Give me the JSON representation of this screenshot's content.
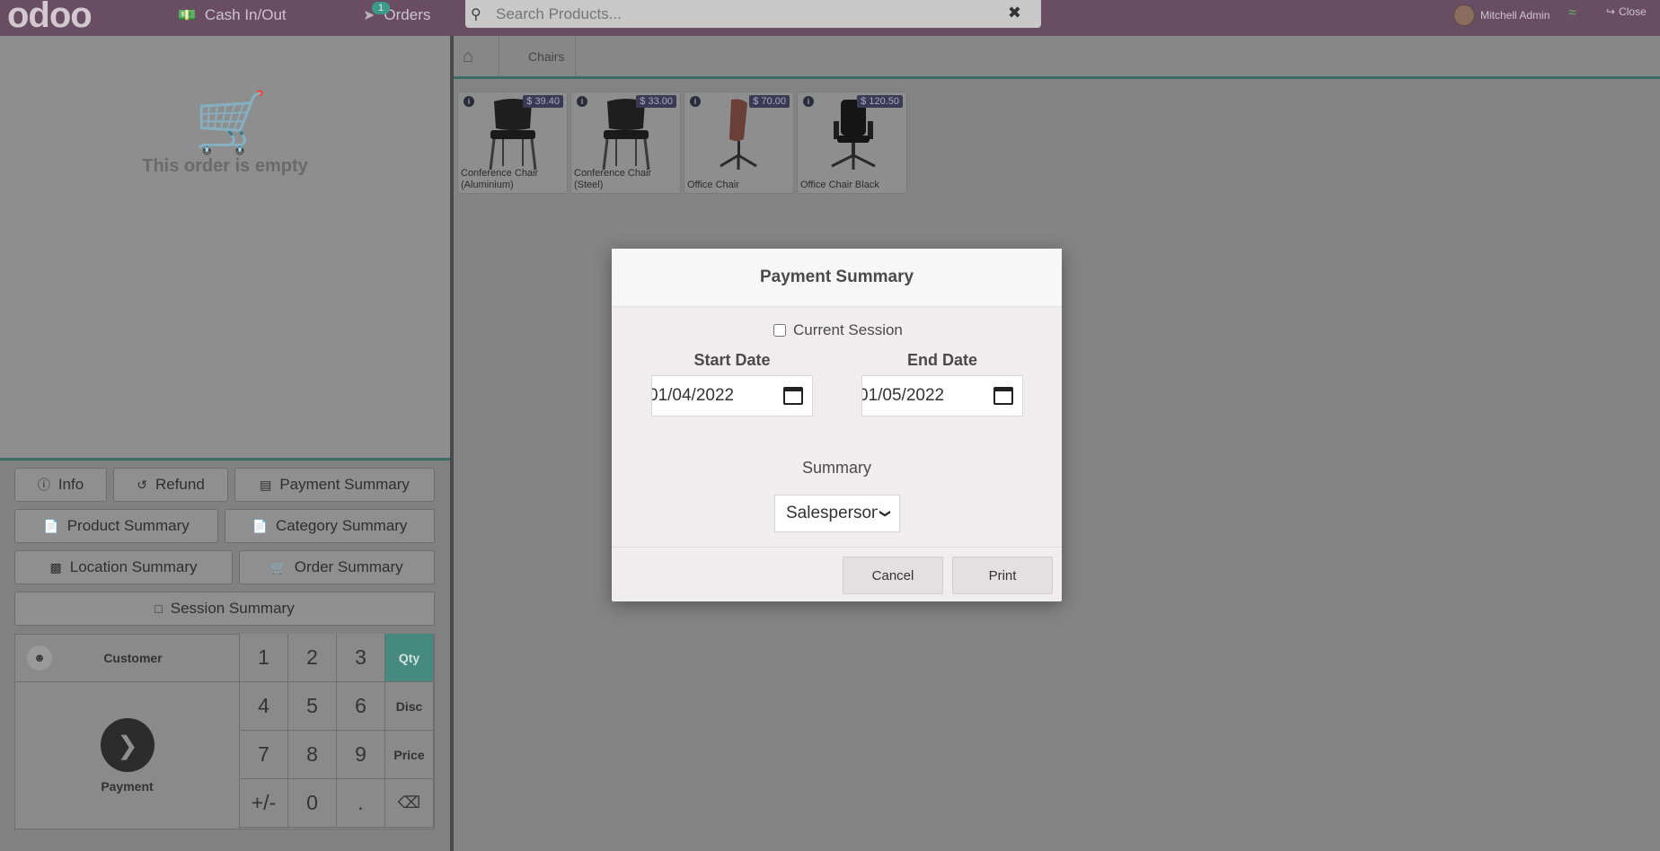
{
  "navbar": {
    "logo": "odoo",
    "cash_label": "Cash In/Out",
    "orders_label": "Orders",
    "orders_badge": "1",
    "search_placeholder": "Search Products...",
    "user_name": "Mitchell Admin",
    "close_label": "Close"
  },
  "order": {
    "empty_text": "This order is empty"
  },
  "controls": {
    "info": "Info",
    "refund": "Refund",
    "payment_summary": "Payment Summary",
    "product_summary": "Product Summary",
    "category_summary": "Category Summary",
    "location_summary": "Location Summary",
    "order_summary": "Order Summary",
    "session_summary": "Session Summary"
  },
  "pad": {
    "customer": "Customer",
    "payment": "Payment",
    "keys": [
      "1",
      "2",
      "3",
      "4",
      "5",
      "6",
      "7",
      "8",
      "9",
      "+/-",
      "0",
      "."
    ],
    "modes": [
      "Qty",
      "Disc",
      "Price"
    ],
    "active_mode": "Qty"
  },
  "breadcrumb": {
    "category": "Chairs"
  },
  "products": [
    {
      "name": "Conference Chair (Aluminium)",
      "price": "$ 39.40"
    },
    {
      "name": "Conference Chair (Steel)",
      "price": "$ 33.00"
    },
    {
      "name": "Office Chair",
      "price": "$ 70.00"
    },
    {
      "name": "Office Chair Black",
      "price": "$ 120.50"
    }
  ],
  "modal": {
    "title": "Payment Summary",
    "current_session_label": "Current Session",
    "current_session_checked": false,
    "start_date_label": "Start Date",
    "start_date_value": "01/04/2022",
    "end_date_label": "End Date",
    "end_date_value": "01/05/2022",
    "summary_label": "Summary",
    "summary_value": "Salesperson",
    "cancel": "Cancel",
    "print": "Print"
  },
  "colors": {
    "navbar": "#694e63",
    "accent": "#46897e"
  }
}
